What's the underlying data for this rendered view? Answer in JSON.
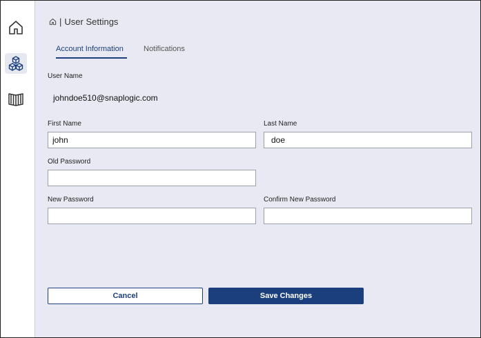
{
  "sidebar": {
    "items": [
      {
        "name": "home",
        "icon": "home-icon"
      },
      {
        "name": "cubes",
        "icon": "cubes-icon",
        "active": true
      },
      {
        "name": "book",
        "icon": "book-icon"
      }
    ]
  },
  "breadcrumb": {
    "icon": "home-icon",
    "separator": "|",
    "title": "User Settings"
  },
  "tabs": [
    {
      "label": "Account Information",
      "active": true
    },
    {
      "label": "Notifications",
      "active": false
    }
  ],
  "form": {
    "user_name_label": "User Name",
    "user_name_value": "johndoe510@snaplogic.com",
    "first_name_label": "First Name",
    "first_name_value": "john",
    "last_name_label": "Last Name",
    "last_name_value": "doe",
    "old_password_label": "Old Password",
    "old_password_value": "",
    "new_password_label": "New Password",
    "new_password_value": "",
    "confirm_password_label": "Confirm New Password",
    "confirm_password_value": ""
  },
  "actions": {
    "cancel_label": "Cancel",
    "save_label": "Save Changes"
  },
  "colors": {
    "accent": "#1b3f7c",
    "background": "#e8e9f2"
  }
}
